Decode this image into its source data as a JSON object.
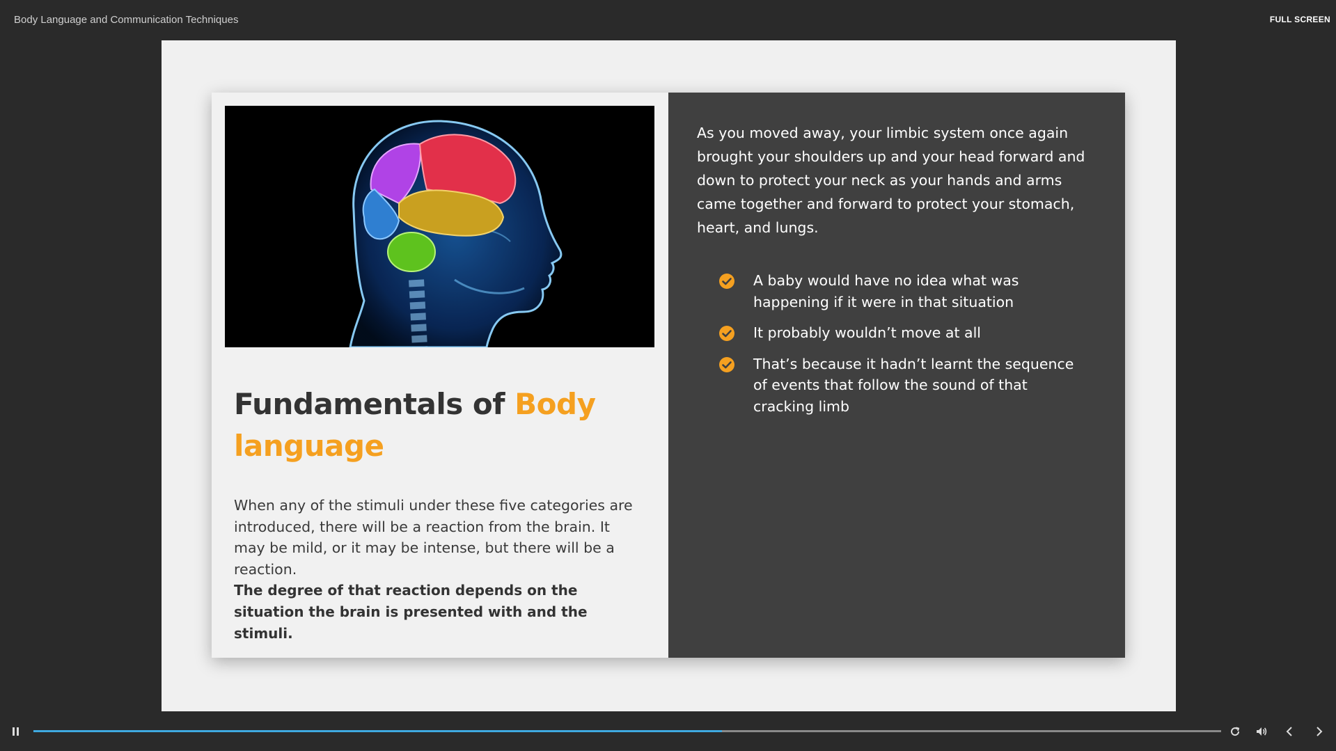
{
  "header": {
    "course_title": "Body Language and Communication Techniques",
    "fullscreen_label": "FULL SCREEN"
  },
  "slide": {
    "image_alt": "brain-head-xray-image",
    "title_part1": "Fundamentals of ",
    "title_accent": "Body language",
    "body_text": "When any of the stimuli under these five categories are introduced, there will be a reaction from the brain. It may be mild, or it may be intense, but there will be a reaction.",
    "bold_text": "The degree of that reaction depends on the situation the brain is presented with and the stimuli.",
    "right_paragraph": "As you moved away, your limbic system once again brought your shoulders up and your head forward and down to protect your neck as your hands and arms came together and forward to protect your stomach, heart, and lungs.",
    "bullets": [
      "A baby would have no idea what was happening if it were in that situation",
      "It probably wouldn’t move at all",
      "That’s because it hadn’t learnt the sequence of events that follow the sound of that cracking limb"
    ]
  },
  "player": {
    "progress_fraction": 0.58,
    "icons": {
      "pause": "pause-icon",
      "replay": "replay-icon",
      "volume": "volume-icon",
      "prev": "chevron-left-icon",
      "next": "chevron-right-icon"
    }
  },
  "colors": {
    "accent": "#f5a020",
    "progress": "#3fa9e0",
    "dark_panel": "#404040",
    "background": "#2a2a2a"
  }
}
